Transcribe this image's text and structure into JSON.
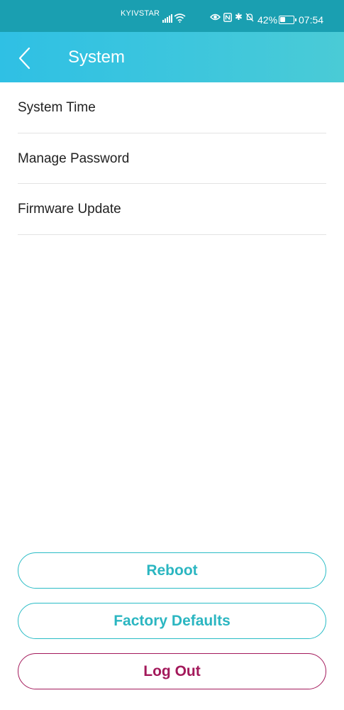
{
  "status_bar": {
    "carrier": "KYIVSTAR",
    "battery_percent": "42%",
    "battery_level": 0.42,
    "time": "07:54",
    "icons": [
      "signal-icon",
      "wifi-icon",
      "eye-icon",
      "nfc-icon",
      "bluetooth-icon",
      "bell-off-icon",
      "battery-icon"
    ]
  },
  "header": {
    "title": "System",
    "back_icon": "chevron-left-icon"
  },
  "menu": {
    "items": [
      {
        "label": "System Time"
      },
      {
        "label": "Manage Password"
      },
      {
        "label": "Firmware Update"
      }
    ]
  },
  "actions": {
    "reboot_label": "Reboot",
    "factory_defaults_label": "Factory Defaults",
    "logout_label": "Log Out"
  },
  "colors": {
    "accent": "#2bb6c1",
    "logout": "#a3195b",
    "header_start": "#2fc0e4",
    "header_end": "#4acbd6"
  }
}
